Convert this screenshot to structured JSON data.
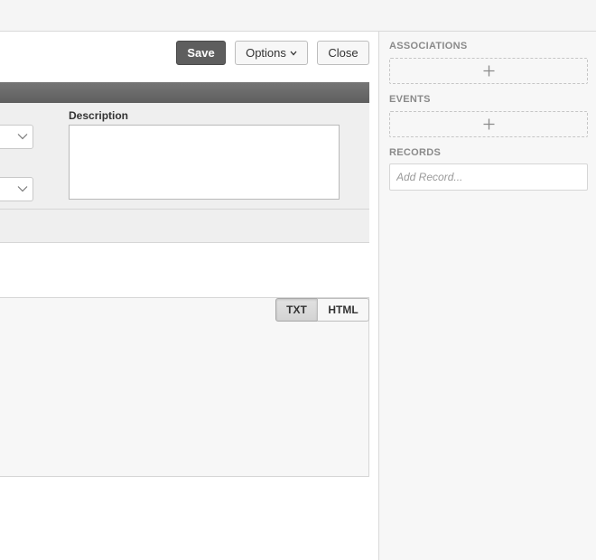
{
  "toolbar": {
    "save_label": "Save",
    "options_label": "Options",
    "close_label": "Close"
  },
  "form": {
    "description_label": "Description",
    "description_value": ""
  },
  "editor": {
    "format_tabs": [
      "TXT",
      "HTML"
    ],
    "selected_format": "TXT"
  },
  "sidebar": {
    "associations_label": "ASSOCIATIONS",
    "events_label": "EVENTS",
    "records_label": "RECORDS",
    "add_record_placeholder": "Add Record..."
  },
  "icons": {
    "add": "plus-icon",
    "dropdown": "chevron-down-icon"
  },
  "colors": {
    "primary_button": "#5e5e5e",
    "header_bar": "#6a6a6a",
    "panel_background": "#efefef",
    "sidebar_background": "#f7f7f7"
  }
}
